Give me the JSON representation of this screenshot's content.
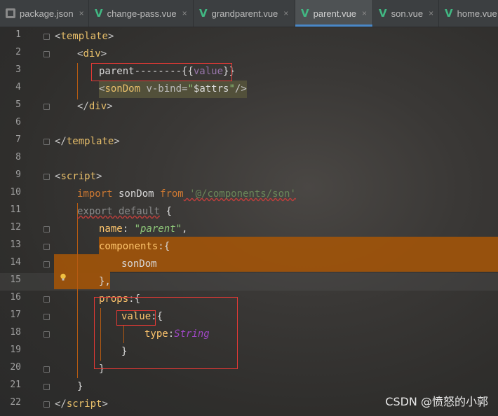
{
  "tabs": [
    {
      "label": "package.json",
      "icon": "json-file-icon",
      "active": false
    },
    {
      "label": "change-pass.vue",
      "icon": "vue-icon",
      "active": false
    },
    {
      "label": "grandparent.vue",
      "icon": "vue-icon",
      "active": false
    },
    {
      "label": "parent.vue",
      "icon": "vue-icon",
      "active": true
    },
    {
      "label": "son.vue",
      "icon": "vue-icon",
      "active": false
    },
    {
      "label": "home.vue",
      "icon": "vue-icon",
      "active": false
    }
  ],
  "close_glyph": "×",
  "vue_glyph": "V",
  "line_numbers": [
    "1",
    "2",
    "3",
    "4",
    "5",
    "6",
    "7",
    "8",
    "9",
    "10",
    "11",
    "12",
    "13",
    "14",
    "15",
    "16",
    "17",
    "18",
    "19",
    "20",
    "21",
    "22"
  ],
  "code": {
    "l1_open": "<",
    "l1_tag": "template",
    "l1_close": ">",
    "l2_open": "<",
    "l2_tag": "div",
    "l2_close": ">",
    "l3_text": "parent--------{{",
    "l3_var": "value",
    "l3_end": "}}",
    "l4_open": "<",
    "l4_tag": "sonDom",
    "l4_attr": " v-bind=",
    "l4_q1": "\"",
    "l4_val": "$attrs",
    "l4_q2": "\"",
    "l4_close": "/>",
    "l5": "</div>",
    "l5_tag": "div",
    "l7_tag": "template",
    "l9_tag": "script",
    "l10_import": "import",
    "l10_name": " sonDom ",
    "l10_from": "from",
    "l10_path": " '@/components/son'",
    "l11_export": "export default",
    "l11_brace": " {",
    "l12_key": "name",
    "l12_colon": ": ",
    "l12_val": "\"parent\"",
    "l12_comma": ",",
    "l13_key": "components",
    "l13_rest": ":{",
    "l14": "sonDom",
    "l15": "},",
    "l16_key": "props",
    "l16_rest": ":{",
    "l17_key": "value",
    "l17_rest": ":{",
    "l18_key": "type",
    "l18_colon": ":",
    "l18_val": "String",
    "l19": "}",
    "l20": "}",
    "l21": "}",
    "l22_tag": "script"
  },
  "watermark": "CSDN @愤怒的小郭",
  "colors": {
    "tag": "#e8bf6a",
    "keyword": "#cc7832",
    "string": "#6a8759",
    "highlight": "#a0540a",
    "redbox": "#e53935",
    "vue": "#41b883"
  }
}
